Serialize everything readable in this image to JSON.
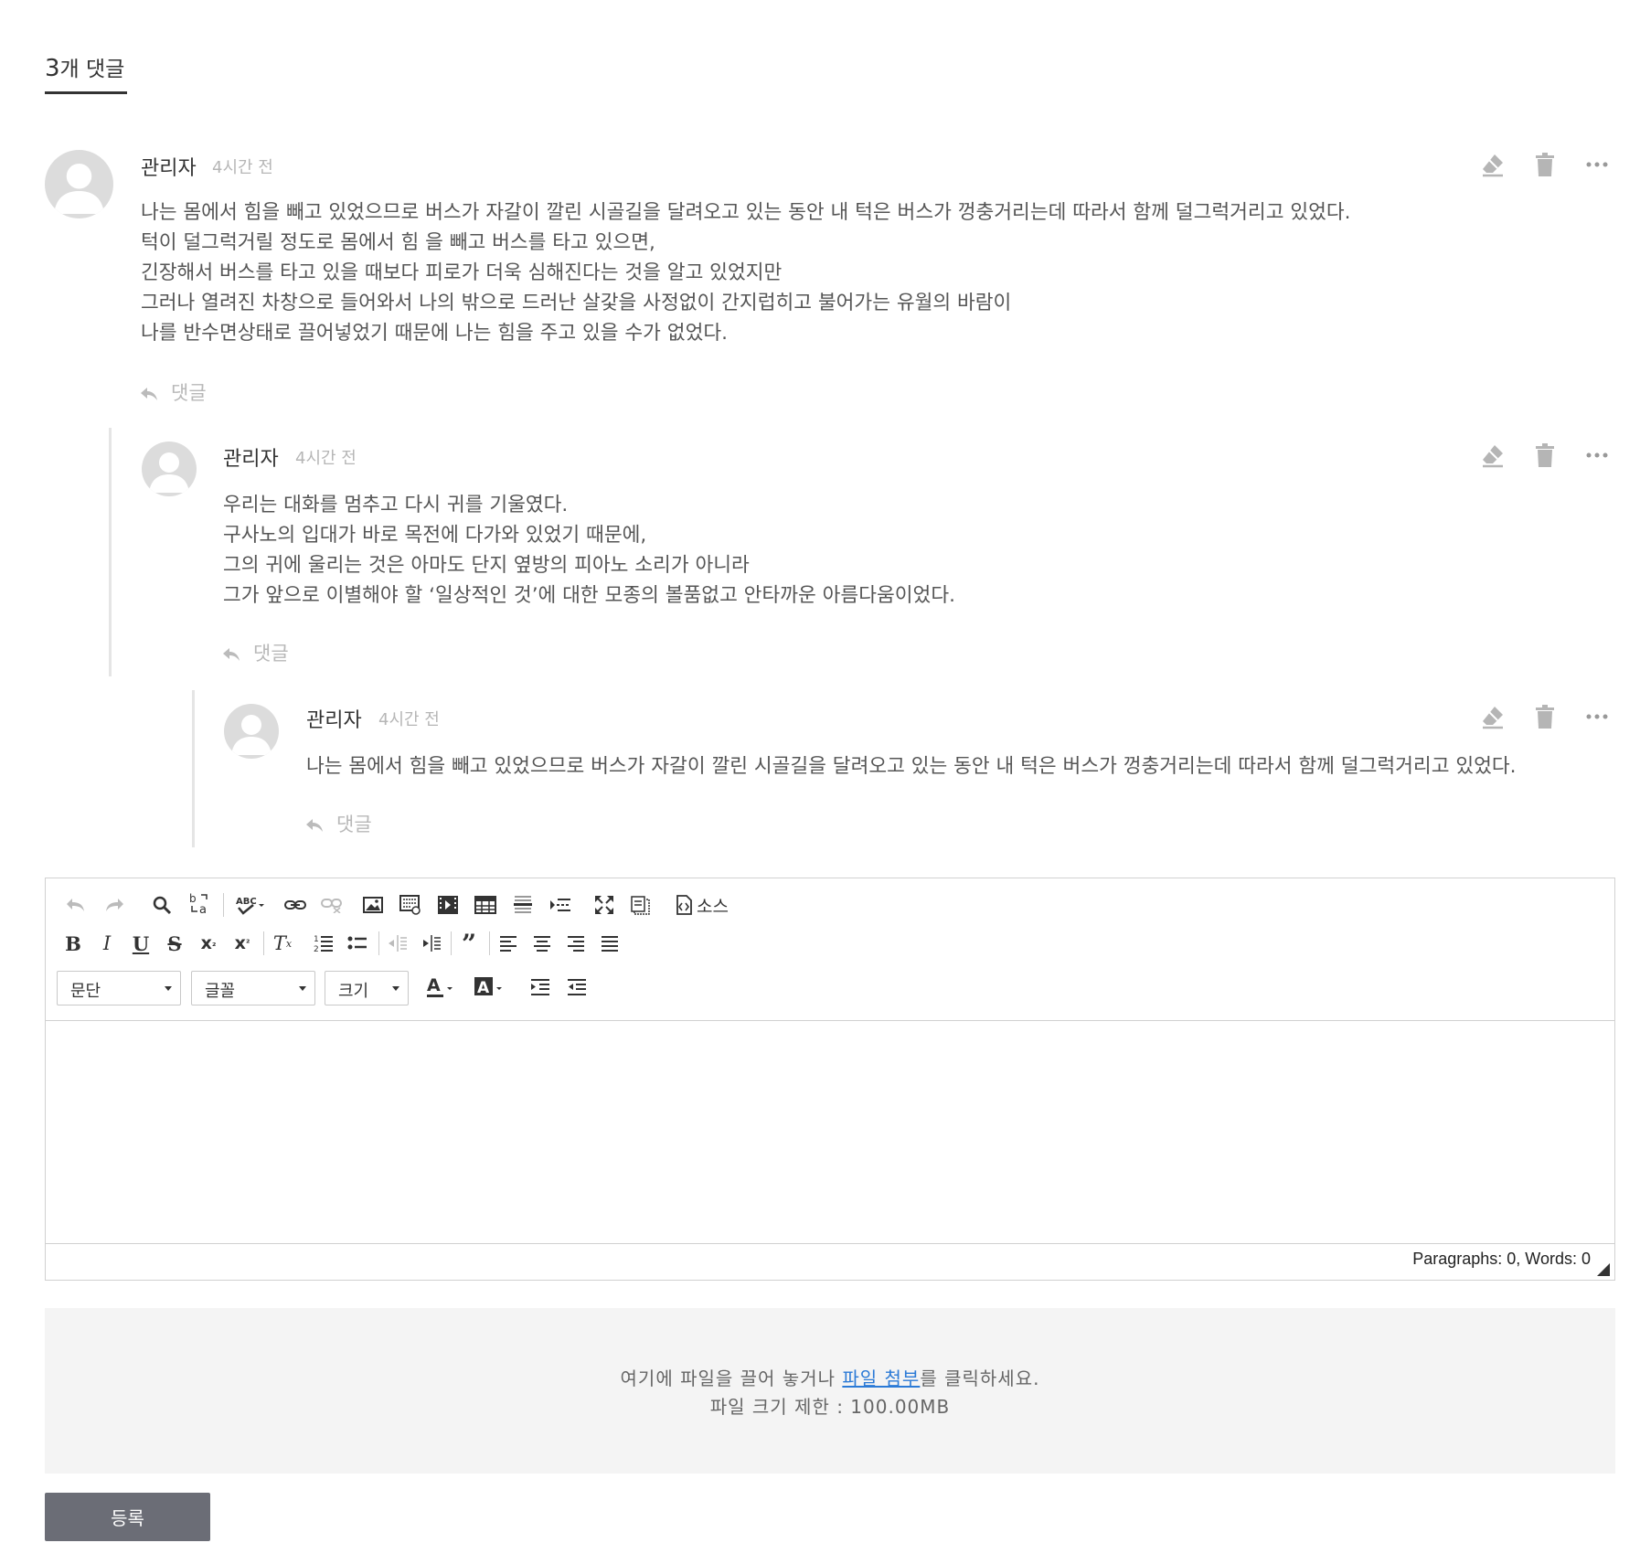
{
  "comments_header": {
    "count": "3",
    "label": "개 댓글"
  },
  "comments": [
    {
      "author": "관리자",
      "time": "4시간 전",
      "lines": [
        "나는 몸에서 힘을 빼고 있었으므로 버스가 자갈이 깔린 시골길을 달려오고 있는 동안 내 턱은 버스가 껑충거리는데 따라서 함께 덜그럭거리고 있었다.",
        "턱이 덜그럭거릴 정도로 몸에서 힘 을 빼고 버스를 타고 있으면,",
        "긴장해서 버스를 타고 있을 때보다 피로가 더욱 심해진다는 것을 알고 있었지만",
        "그러나 열려진 차창으로 들어와서 나의 밖으로 드러난 살갗을 사정없이 간지럽히고 불어가는 유월의 바람이",
        "나를 반수면상태로 끌어넣었기 때문에 나는 힘을 주고 있을 수가 없었다."
      ],
      "reply_label": "댓글"
    },
    {
      "author": "관리자",
      "time": "4시간 전",
      "lines": [
        "우리는 대화를 멈추고 다시 귀를 기울였다.",
        "구사노의 입대가 바로 목전에 다가와 있었기 때문에,",
        "그의 귀에 울리는 것은 아마도 단지 옆방의 피아노 소리가 아니라",
        "그가 앞으로 이별해야 할 ‘일상적인 것’에 대한 모종의 볼품없고 안타까운 아름다움이었다."
      ],
      "reply_label": "댓글"
    },
    {
      "author": "관리자",
      "time": "4시간 전",
      "lines": [
        "나는 몸에서 힘을 빼고 있었으므로 버스가 자갈이 깔린 시골길을 달려오고 있는 동안 내 턱은 버스가 껑충거리는데 따라서 함께 덜그럭거리고 있었다."
      ],
      "reply_label": "댓글"
    }
  ],
  "editor": {
    "source_label": "소스",
    "format_select": "문단",
    "font_select": "글꼴",
    "size_select": "크기",
    "status": "Paragraphs: 0, Words: 0",
    "icons_row1": [
      "undo-icon",
      "redo-icon",
      "find-icon",
      "replace-icon",
      "spellcheck-icon",
      "link-icon",
      "unlink-icon",
      "image-icon",
      "gallery-icon",
      "video-icon",
      "table-icon",
      "horizontal-rule-icon",
      "page-break-icon",
      "maximize-icon",
      "show-blocks-icon",
      "source-icon"
    ],
    "icons_row2": [
      "bold-icon",
      "italic-icon",
      "underline-icon",
      "strike-icon",
      "subscript-icon",
      "superscript-icon",
      "remove-format-icon",
      "numbered-list-icon",
      "bulleted-list-icon",
      "outdent-icon",
      "indent-icon",
      "blockquote-icon",
      "align-left-icon",
      "align-center-icon",
      "align-right-icon",
      "justify-icon"
    ],
    "icons_row3": [
      "text-color-icon",
      "background-color-icon",
      "indent-block-icon",
      "outdent-block-icon"
    ]
  },
  "dropzone": {
    "text_before": "여기에 파일을 끌어 놓거나 ",
    "link": "파일 첨부",
    "text_after": "를 클릭하세요.",
    "limit": "파일 크기 제한 : 100.00MB"
  },
  "submit_label": "등록"
}
